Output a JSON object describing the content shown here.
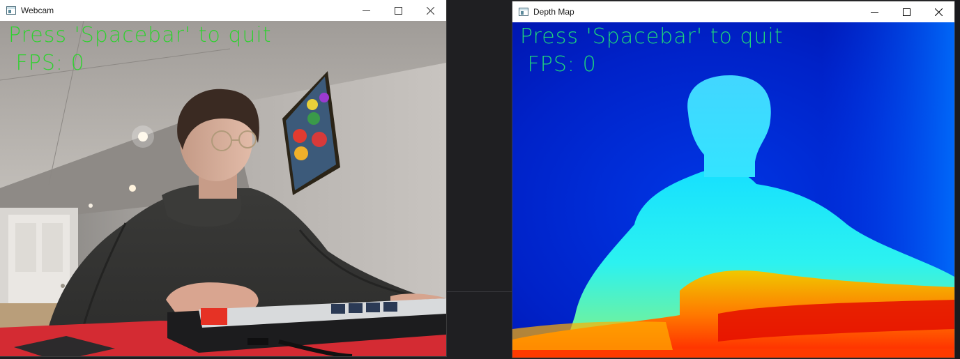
{
  "webcam_window": {
    "title": "Webcam",
    "overlay_line1": "Press 'Spacebar' to quit",
    "overlay_line2": " FPS: 0"
  },
  "depth_window": {
    "title": "Depth Map",
    "overlay_line1": "Press 'Spacebar' to quit",
    "overlay_line2": " FPS: 0"
  },
  "colors": {
    "overlay_text_webcam": "#2fd12f",
    "overlay_text_depth": "#1fd67a",
    "depth_far": "#0012b8",
    "depth_mid": "#00e8ff",
    "depth_near": "#ff2000"
  },
  "icons": [
    "app-window-icon",
    "minimize-icon",
    "maximize-icon",
    "close-icon"
  ]
}
